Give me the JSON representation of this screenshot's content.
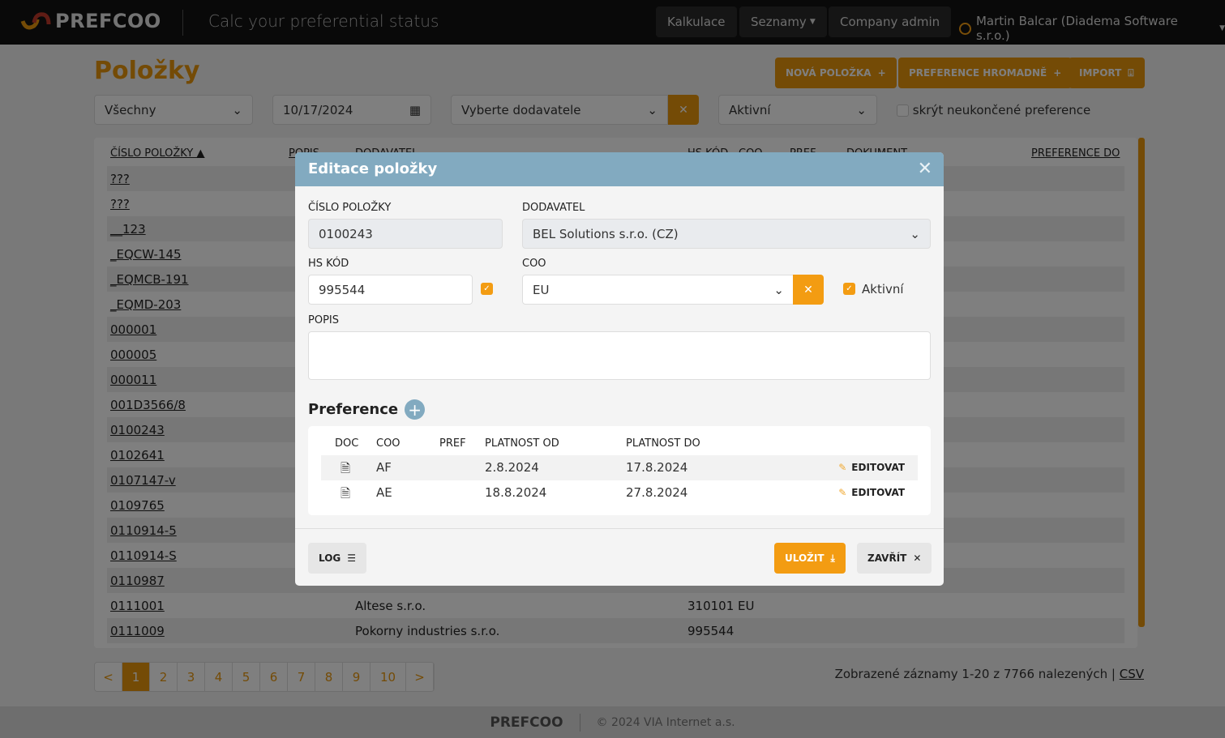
{
  "brand": {
    "name": "PREFCOO",
    "tagline": "Calc your preferential status",
    "accent": "#e8960c"
  },
  "nav": {
    "items": [
      "Kalkulace",
      "Seznamy",
      "Company admin"
    ],
    "user": "Martin Balcar (Diadema Software s.r.o.)"
  },
  "page": {
    "title": "Položky",
    "buttons": {
      "new": "NOVÁ POLOŽKA",
      "bulk": "PREFERENCE HROMADNĚ",
      "import": "IMPORT"
    }
  },
  "filters": {
    "type": "Všechny",
    "date": "10/17/2024",
    "supplier_placeholder": "Vyberte dodavatele",
    "status": "Aktivní",
    "hide_label": "skrýt neukončené preference"
  },
  "table": {
    "headers": {
      "number": "ČÍSLO POLOŽKY ▲",
      "desc": "POPIS",
      "supplier": "DODAVATEL",
      "hs": "HS KÓD",
      "coo": "COO",
      "pref": "PREF",
      "doc": "DOKUMENT",
      "pref_to": "PREFERENCE DO"
    },
    "rows": [
      {
        "n": "???"
      },
      {
        "n": "???"
      },
      {
        "n": "__123"
      },
      {
        "n": "_EQCW-145"
      },
      {
        "n": "_EQMCB-191"
      },
      {
        "n": "_EQMD-203"
      },
      {
        "n": "000001"
      },
      {
        "n": "000005"
      },
      {
        "n": "000011"
      },
      {
        "n": "001D3566/8"
      },
      {
        "n": "0100243"
      },
      {
        "n": "0102641"
      },
      {
        "n": "0107147-v"
      },
      {
        "n": "0109765"
      },
      {
        "n": "0110914-5"
      },
      {
        "n": "0110914-S"
      },
      {
        "n": "0110987"
      },
      {
        "n": "0111001",
        "s": "Altese s.r.o.",
        "hs": "310101",
        "coo": "EU"
      },
      {
        "n": "0111009",
        "s": "Pokorny industries s.r.o.",
        "hs": "995544",
        "coo": ""
      }
    ]
  },
  "pagination": {
    "prev": "<",
    "pages": [
      "1",
      "2",
      "3",
      "4",
      "5",
      "6",
      "7",
      "8",
      "9",
      "10"
    ],
    "next": ">",
    "active": "1",
    "records": "Zobrazené záznamy 1-20 z 7766 nalezených |",
    "csv": "CSV"
  },
  "footer": {
    "brand": "PREFCOO",
    "copyright": "© 2024 VIA Internet a.s."
  },
  "modal": {
    "title": "Editace položky",
    "labels": {
      "number": "ČÍSLO POLOŽKY",
      "supplier": "DODAVATEL",
      "hs": "HS KÓD",
      "coo": "COO",
      "desc": "POPIS",
      "active": "Aktivní"
    },
    "values": {
      "number": "0100243",
      "supplier": "BEL Solutions s.r.o. (CZ)",
      "hs": "995544",
      "coo": "EU",
      "desc": "",
      "hs_checked": true,
      "active_checked": true
    },
    "preference": {
      "title": "Preference",
      "headers": [
        "DOC",
        "COO",
        "PREF",
        "PLATNOST OD",
        "PLATNOST DO"
      ],
      "rows": [
        {
          "coo": "AF",
          "pref": "",
          "from": "2.8.2024",
          "to": "17.8.2024",
          "edit": "EDITOVAT"
        },
        {
          "coo": "AE",
          "pref": "",
          "from": "18.8.2024",
          "to": "27.8.2024",
          "edit": "EDITOVAT"
        }
      ]
    },
    "buttons": {
      "log": "LOG",
      "save": "ULOŽIT",
      "close": "ZAVŘÍT"
    }
  }
}
